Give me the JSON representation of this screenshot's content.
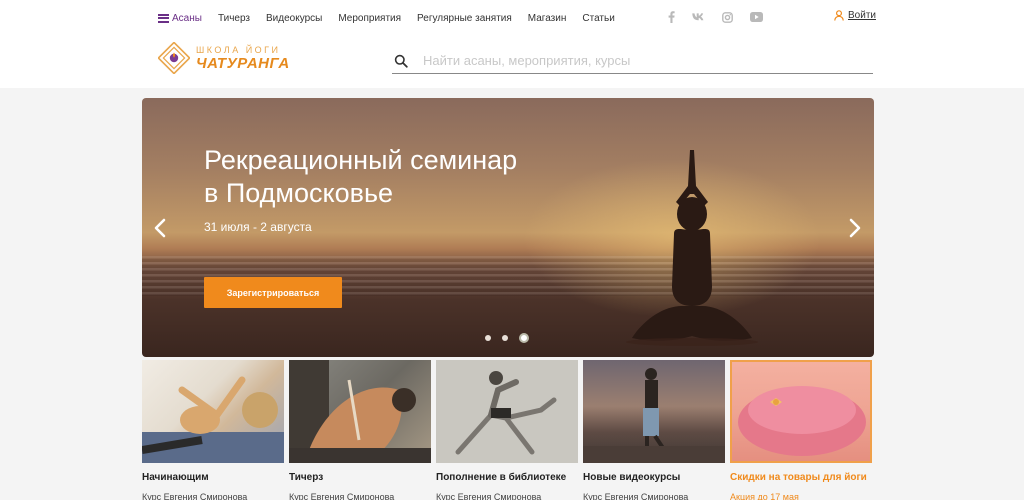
{
  "nav": {
    "items": [
      "Асаны",
      "Тичерз",
      "Видеокурсы",
      "Мероприятия",
      "Регулярные занятия",
      "Магазин",
      "Статьи"
    ],
    "active": 0
  },
  "socials": [
    "facebook-icon",
    "vk-icon",
    "instagram-icon",
    "youtube-icon"
  ],
  "login": {
    "label": "Войти"
  },
  "logo": {
    "top": "ШКОЛА ЙОГИ",
    "main": "ЧАТУРАНГА"
  },
  "search": {
    "placeholder": "Найти асаны, мероприятия, курсы",
    "value": ""
  },
  "hero": {
    "title_line1": "Рекреационный семинар",
    "title_line2": "в Подмосковье",
    "dates": "31 июля - 2 августа",
    "register_label": "Зарегистрироваться",
    "slides": 3,
    "active_slide": 3
  },
  "cards": [
    {
      "title": "Начинающим",
      "subtitle": "Курс Евгения Смиронова"
    },
    {
      "title": "Тичерз",
      "subtitle": "Курс Евгения Смиронова"
    },
    {
      "title": "Пополнение в библиотеке",
      "subtitle": "Курс Евгения Смиронова"
    },
    {
      "title": "Новые видеокурсы",
      "subtitle": "Курс Евгения Смиронова"
    },
    {
      "title": "Скидки на товары для йоги",
      "subtitle": "Акция до 17 мая"
    }
  ],
  "colors": {
    "brand": "#6a2f86",
    "accent": "#f08a1c"
  }
}
